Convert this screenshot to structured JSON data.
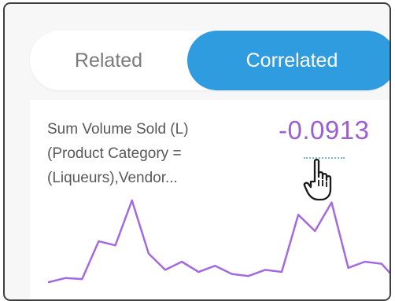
{
  "toggle": {
    "related_label": "Related",
    "correlated_label": "Correlated",
    "active": "Correlated"
  },
  "card": {
    "title_lines": [
      "Sum Volume Sold (L)",
      "(Product Category =",
      "(Liqueurs),Vendor..."
    ],
    "correlation_value": "-0.0913"
  },
  "colors": {
    "accent": "#2f9ce0",
    "value": "#9b5fd2",
    "line": "#a36ae0",
    "border": "#3f3f3f"
  },
  "icons": {
    "cursor": "hand-pointer-icon"
  },
  "sparkline": {
    "values": [
      2,
      6,
      5,
      42,
      38,
      82,
      30,
      14,
      22,
      12,
      18,
      10,
      8,
      14,
      12,
      68,
      52,
      80,
      16,
      22,
      20,
      2
    ]
  }
}
